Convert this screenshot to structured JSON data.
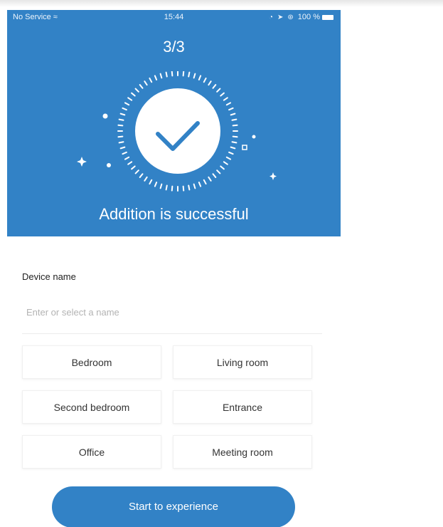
{
  "status_bar": {
    "carrier": "No Service",
    "time": "15:44",
    "battery_percent": "100 %"
  },
  "header": {
    "step": "3/3",
    "title": "Addition is successful"
  },
  "form": {
    "label": "Device name",
    "placeholder": "Enter or select a name",
    "value": ""
  },
  "rooms": [
    {
      "label": "Bedroom"
    },
    {
      "label": "Living room"
    },
    {
      "label": "Second bedroom"
    },
    {
      "label": "Entrance"
    },
    {
      "label": "Office"
    },
    {
      "label": "Meeting room"
    }
  ],
  "actions": {
    "start_label": "Start to experience"
  },
  "colors": {
    "primary": "#3282c6",
    "background": "#ffffff"
  },
  "icons": {
    "wifi": "wifi-icon",
    "success": "checkmark-icon",
    "battery": "battery-icon"
  }
}
